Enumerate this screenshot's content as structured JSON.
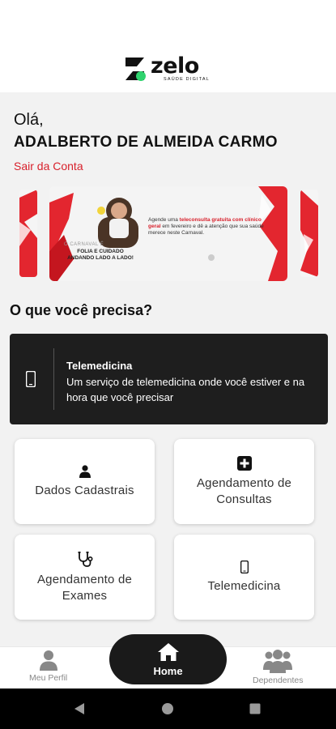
{
  "brand": {
    "name": "zelo",
    "tagline": "SAÚDE DIGITAL",
    "accent": "#d8212c",
    "dark": "#1e1e1e"
  },
  "user": {
    "greeting": "Olá,",
    "full_name": "ADALBERTO DE ALMEIDA CARMO",
    "logout_label": "Sair da Conta"
  },
  "banner": {
    "small_heading": "O CARNAVAL É",
    "headline": "FOLIA E CUIDADO ANDANDO LADO A LADO!",
    "text_before": "Agende uma ",
    "text_bold": "teleconsulta gratuita com clínico geral",
    "text_after": " em fevereiro e dê a atenção que sua saúde merece neste Carnaval."
  },
  "services": {
    "title": "O que você precisa?",
    "featured": {
      "icon": "smartphone-icon",
      "title": "Telemedicina",
      "description": "Um serviço de telemedicina onde você estiver e na hora que você precisar"
    },
    "tiles": [
      {
        "icon": "person-icon",
        "label": "Dados Cadastrais"
      },
      {
        "icon": "plus-square-icon",
        "label": "Agendamento de Consultas"
      },
      {
        "icon": "stethoscope-icon",
        "label": "Agendamento de Exames"
      },
      {
        "icon": "smartphone-icon",
        "label": "Telemedicina"
      }
    ]
  },
  "nav": {
    "profile_label": "Meu Perfil",
    "home_label": "Home",
    "dependents_label": "Dependentes"
  }
}
